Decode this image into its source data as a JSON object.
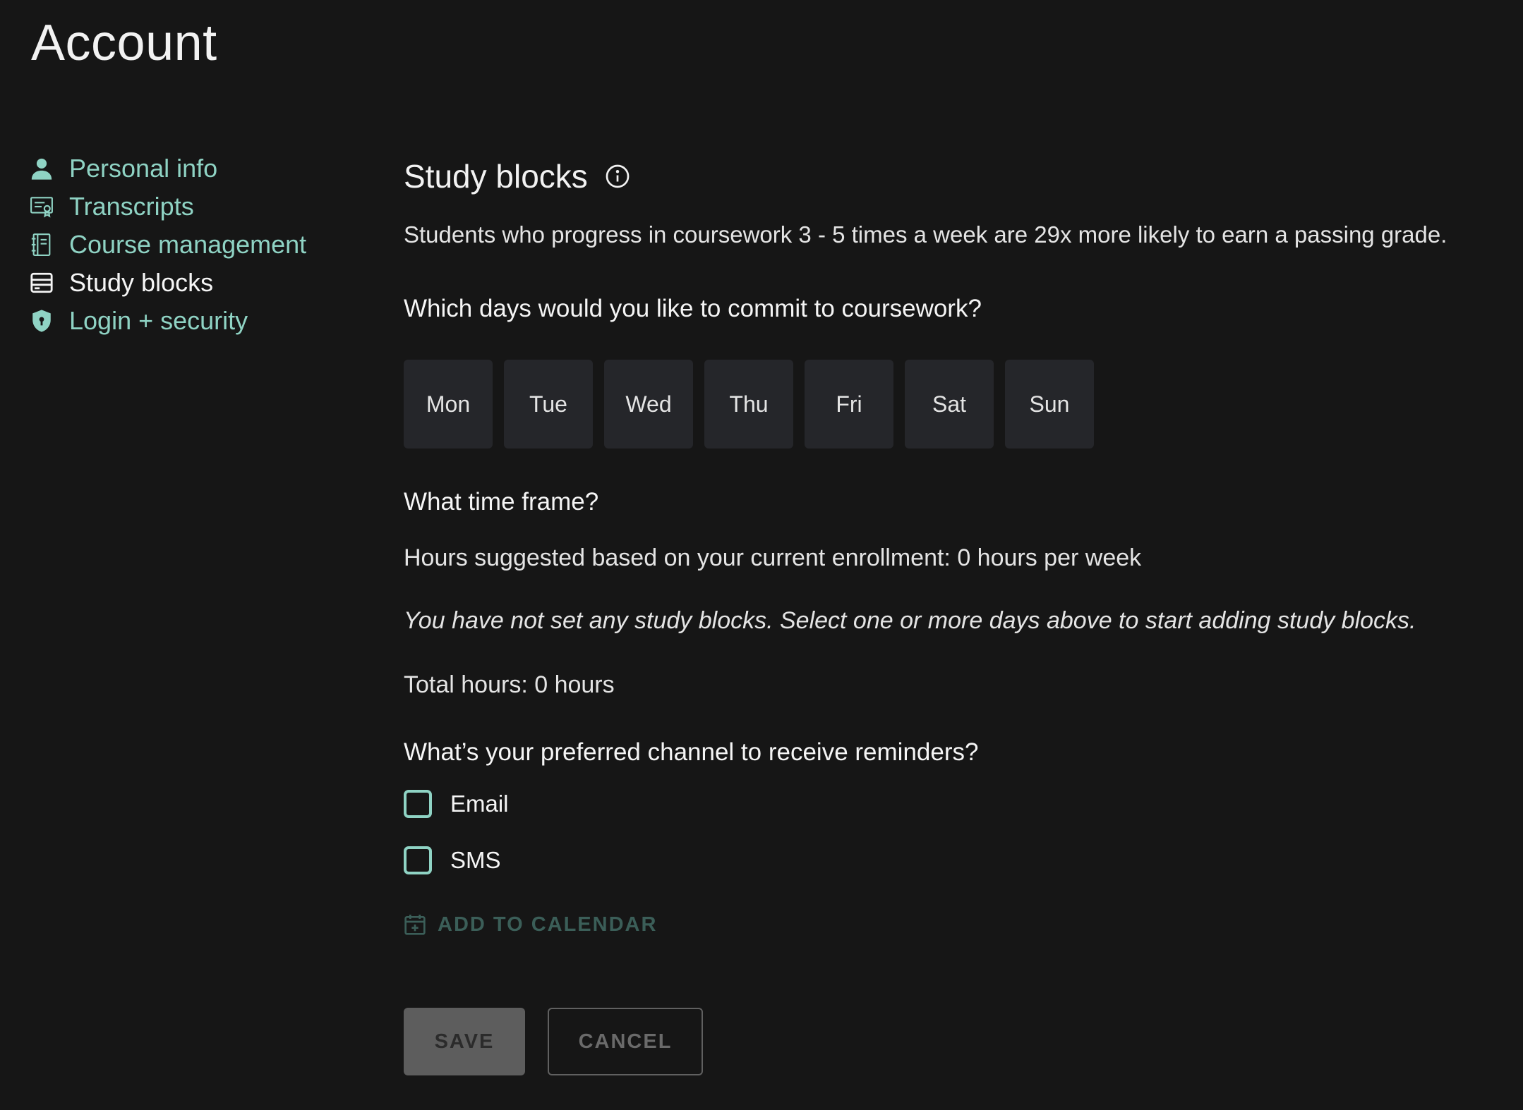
{
  "page": {
    "title": "Account"
  },
  "sidebar": {
    "items": [
      {
        "label": "Personal info",
        "icon": "person-icon",
        "active": false
      },
      {
        "label": "Transcripts",
        "icon": "certificate-icon",
        "active": false
      },
      {
        "label": "Course management",
        "icon": "notebook-icon",
        "active": false
      },
      {
        "label": "Study blocks",
        "icon": "card-icon",
        "active": true
      },
      {
        "label": "Login + security",
        "icon": "shield-icon",
        "active": false
      }
    ]
  },
  "main": {
    "section_title": "Study blocks",
    "intro": "Students who progress in coursework 3 - 5 times a week are 29x more likely to earn a passing grade.",
    "days_question": "Which days would you like to commit to coursework?",
    "days": [
      "Mon",
      "Tue",
      "Wed",
      "Thu",
      "Fri",
      "Sat",
      "Sun"
    ],
    "time_question": "What time frame?",
    "hours_suggested": "Hours suggested based on your current enrollment: 0 hours per week",
    "no_blocks_message": "You have not set any study blocks. Select one or more days above to start adding study blocks.",
    "total_hours": "Total hours: 0 hours",
    "channel_question": "What’s your preferred channel to receive reminders?",
    "channels": [
      {
        "label": "Email",
        "checked": false
      },
      {
        "label": "SMS",
        "checked": false
      }
    ],
    "add_to_calendar": "ADD TO CALENDAR",
    "save_label": "SAVE",
    "cancel_label": "CANCEL"
  },
  "colors": {
    "background": "#161616",
    "accent": "#8fd3c4",
    "day_tile": "#25262a",
    "disabled_link": "#3b5e58",
    "save_button": "#5d5d5d"
  }
}
